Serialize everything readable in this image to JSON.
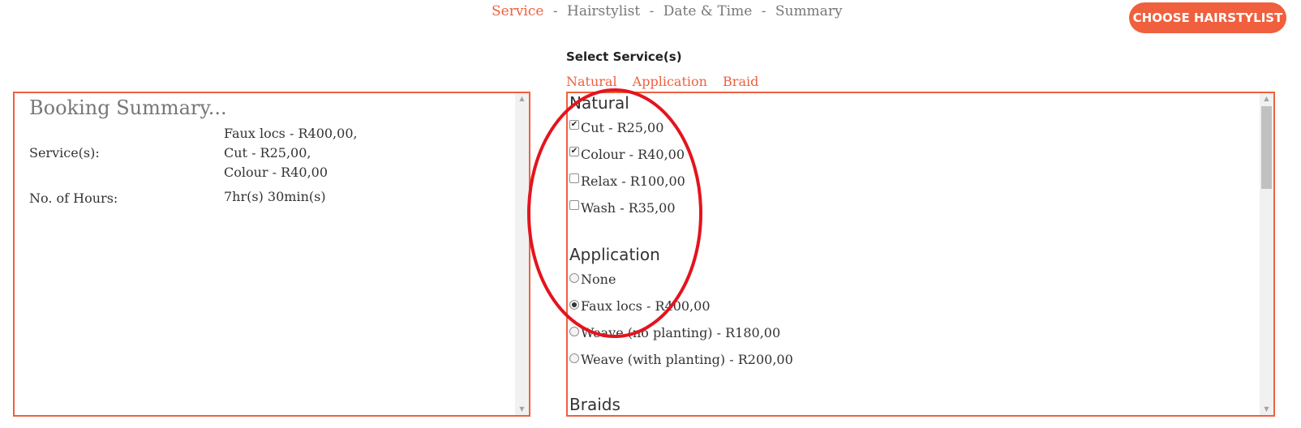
{
  "wizard": {
    "steps": [
      "Service",
      "Hairstylist",
      "Date & Time",
      "Summary"
    ],
    "separator": "-"
  },
  "header": {
    "choose_button": "CHOOSE HAIRSTYLIST"
  },
  "services": {
    "heading": "Select Service(s)",
    "category_links": [
      "Natural",
      "Application",
      "Braid"
    ],
    "groups": [
      {
        "title": "Natural",
        "input": "checkbox",
        "options": [
          {
            "label": "Cut - R25,00",
            "checked": true
          },
          {
            "label": "Colour - R40,00",
            "checked": true
          },
          {
            "label": "Relax - R100,00",
            "checked": false
          },
          {
            "label": "Wash - R35,00",
            "checked": false
          }
        ]
      },
      {
        "title": "Application",
        "input": "radio",
        "options": [
          {
            "label": "None",
            "checked": false
          },
          {
            "label": "Faux locs - R400,00",
            "checked": true
          },
          {
            "label": "Weave (no planting) - R180,00",
            "checked": false
          },
          {
            "label": "Weave (with planting) - R200,00",
            "checked": false
          }
        ]
      },
      {
        "title": "Braids"
      }
    ]
  },
  "summary": {
    "title": "Booking Summary...",
    "services_label": "Service(s):",
    "services_values": [
      "Faux locs - R400,00,",
      "Cut - R25,00,",
      "Colour - R40,00"
    ],
    "hours_label": "No. of Hours:",
    "hours_value": "7hr(s) 30min(s)"
  },
  "colors": {
    "accent": "#f0603e",
    "annotation": "#e3141e",
    "muted": "#777777"
  }
}
